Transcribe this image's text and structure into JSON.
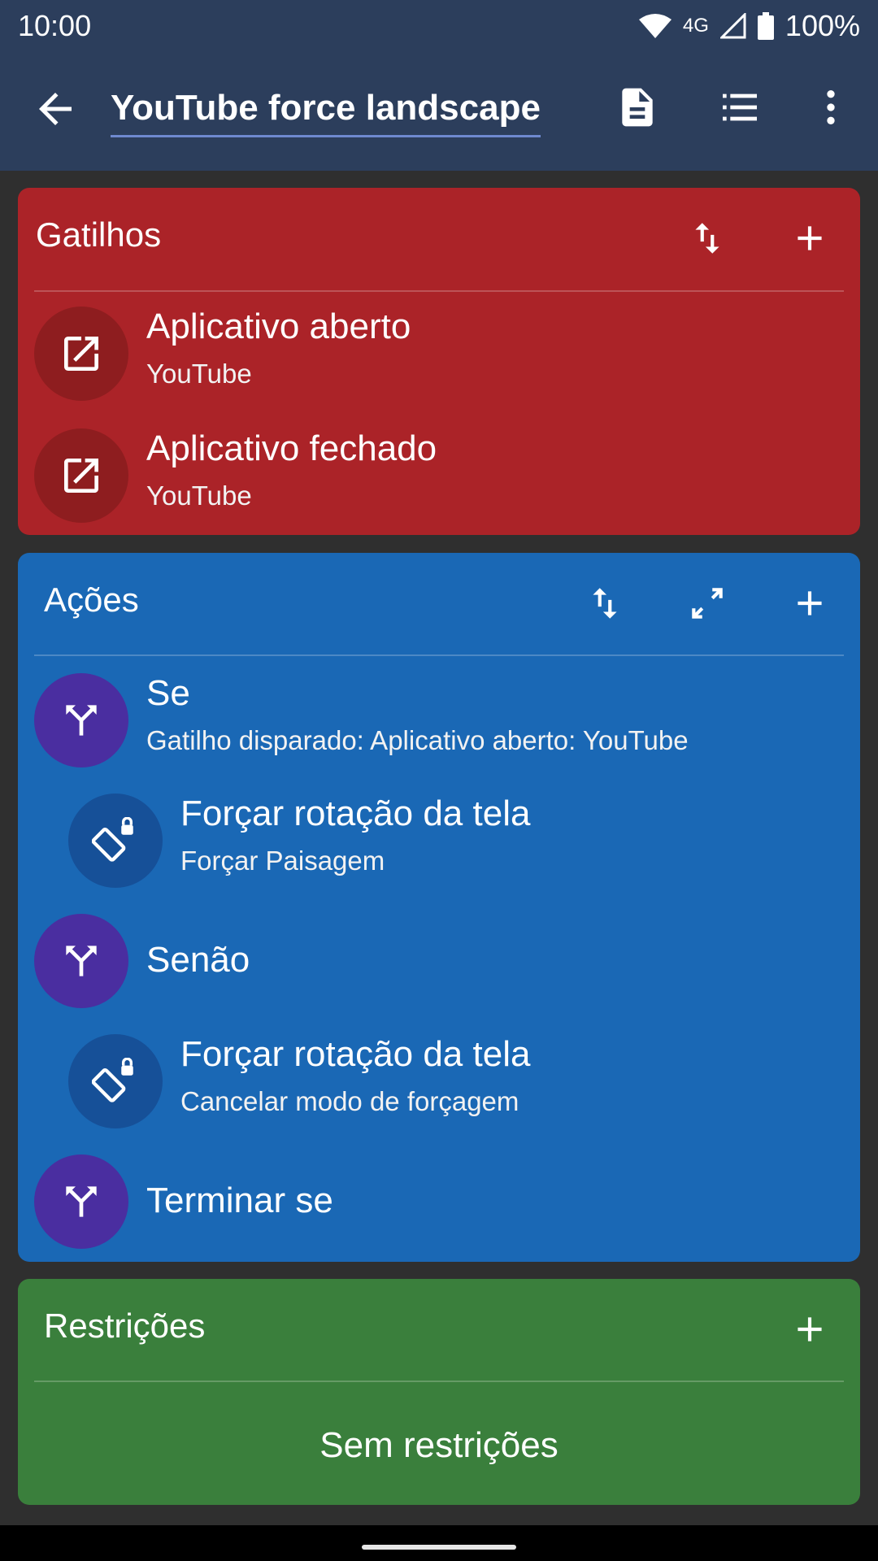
{
  "status": {
    "time": "10:00",
    "network": "4G",
    "battery": "100%"
  },
  "appbar": {
    "title": "YouTube force landscape"
  },
  "triggers": {
    "header": "Gatilhos",
    "items": [
      {
        "title": "Aplicativo aberto",
        "subtitle": "YouTube"
      },
      {
        "title": "Aplicativo fechado",
        "subtitle": "YouTube"
      }
    ]
  },
  "actions": {
    "header": "Ações",
    "items": [
      {
        "title": "Se",
        "subtitle": "Gatilho disparado: Aplicativo aberto: YouTube"
      },
      {
        "title": "Forçar rotação da tela",
        "subtitle": "Forçar Paisagem"
      },
      {
        "title": "Senão"
      },
      {
        "title": "Forçar rotação da tela",
        "subtitle": "Cancelar modo de forçagem"
      },
      {
        "title": "Terminar se"
      }
    ]
  },
  "constraints": {
    "header": "Restrições",
    "empty": "Sem restrições"
  },
  "colors": {
    "triggers": "#ab2328",
    "actions": "#1a68b5",
    "constraints": "#3a7f3c",
    "appbar": "#2c3e5c"
  }
}
